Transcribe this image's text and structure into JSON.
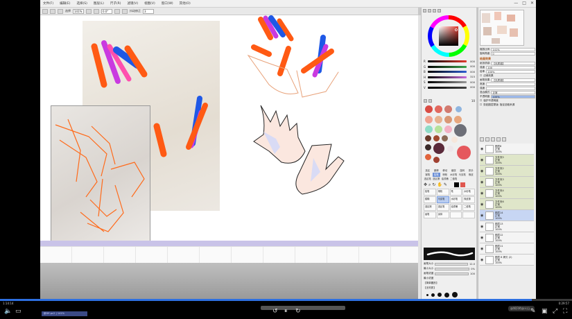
{
  "app": {
    "menu": [
      "文件(F)",
      "编辑(E)",
      "选择(S)",
      "图层(L)",
      "尺子(R)",
      "滤镜(V)",
      "视图(V)",
      "窗口(W)",
      "其他(O)"
    ],
    "window_controls": [
      "—",
      "□",
      "✕"
    ]
  },
  "toolbar": {
    "selection_label": "选择",
    "zoom_value": "141%",
    "angle_value": "0.0°",
    "stabilizer_label": "抖动修正",
    "stabilizer_value": "3"
  },
  "color_panel": {
    "sliders": [
      {
        "label": "R",
        "value": "000",
        "color": "#e23a2e"
      },
      {
        "label": "G",
        "value": "000",
        "color": "#3aa54a"
      },
      {
        "label": "B",
        "value": "000",
        "color": "#2f5fd3"
      },
      {
        "label": "H",
        "value": "315",
        "color": "#c86bdc"
      },
      {
        "label": "S",
        "value": "000",
        "color": "#999999"
      },
      {
        "label": "V",
        "value": "000",
        "color": "#444444"
      }
    ],
    "swatch_size": "10"
  },
  "tools": {
    "row1": [
      "选区",
      "魔棒",
      "移动",
      "缩放",
      "旋转",
      "抓手"
    ],
    "row2": [
      "钢笔",
      "铅笔",
      "喷枪",
      "水彩笔",
      "马克笔",
      "橡皮"
    ],
    "row3": [
      "选区笔",
      "选区擦",
      "油漆桶",
      "二值笔",
      "",
      ""
    ],
    "brushes": [
      "铅笔",
      "喷枪",
      "笔",
      "水彩笔",
      "模糊",
      "马克笔",
      "水彩笔",
      "橡皮擦",
      "选区擦",
      "选区笔",
      "油漆桶",
      "二值笔",
      "画笔",
      "涂抹",
      "",
      ""
    ]
  },
  "brush_params": {
    "size_label": "画笔大小",
    "size_value": "12.0",
    "min_size_label": "最小大小",
    "min_size_value": "0%",
    "density_label": "画笔浓度",
    "density_value": "100",
    "min_density_label": "最小浓度",
    "shape_label": "【简单圆形】",
    "texture_label": "【无材质】"
  },
  "navigator": {
    "zoom_label": "缩放比例",
    "zoom_value": "141%",
    "angle_label": "旋转角度",
    "angle_value": "0"
  },
  "layer_props": {
    "section_title": "绘画效果",
    "texture_label": "纸张质感",
    "texture_value": "【无质感】",
    "strength_label": "强度",
    "strength_value": "100",
    "scale_label": "倍率",
    "scale_value": "100%",
    "edge_check": "边缘效果",
    "brush_effect_label": "画笔效果",
    "brush_effect_value": "【无质感】",
    "width_label": "宽度",
    "strength2_label": "强度",
    "blend_label": "混合模式",
    "blend_value": "正常",
    "opacity_label": "不透明度",
    "opacity_value": "100%",
    "protect_label": "保护不透明度",
    "clip_label": "剪贴图层蒙版",
    "sel_src_label": "指定选取来源"
  },
  "layers": [
    {
      "name": "图层8",
      "mode": "正常",
      "opacity": "100%",
      "type": "layer"
    },
    {
      "name": "文件夹5",
      "mode": "正常",
      "opacity": "100%",
      "type": "folder"
    },
    {
      "name": "文件夹2",
      "mode": "正常",
      "opacity": "100%",
      "type": "folder"
    },
    {
      "name": "文件夹3",
      "mode": "正常",
      "opacity": "100%",
      "type": "folder"
    },
    {
      "name": "文件夹4",
      "mode": "正常",
      "opacity": "100%",
      "type": "folder"
    },
    {
      "name": "文件夹6",
      "mode": "正常",
      "opacity": "100%",
      "type": "folder"
    },
    {
      "name": "图层14",
      "mode": "正常",
      "opacity": "100%",
      "type": "selected"
    },
    {
      "name": "图层13",
      "mode": "正常",
      "opacity": "100%",
      "type": "layer"
    },
    {
      "name": "图层12",
      "mode": "正常",
      "opacity": "100%",
      "type": "layer"
    },
    {
      "name": "图层11",
      "mode": "正常",
      "opacity": "100%",
      "type": "layer"
    },
    {
      "name": "图层 8 拷贝 (2)",
      "mode": "正常",
      "opacity": "100%",
      "type": "layer"
    }
  ],
  "player": {
    "time_current": "1:14:14",
    "time_total": "0:29:57",
    "progress": 0.93,
    "taskbar_label": "新DE.pc2 | 141%",
    "watermark": "@知识的@火山..."
  },
  "colors": {
    "accent": "#2d6fe0",
    "folder_row": "#dfe6c9",
    "selected_row": "#c7d6f3",
    "canvas_band": "#c9c3e8"
  }
}
